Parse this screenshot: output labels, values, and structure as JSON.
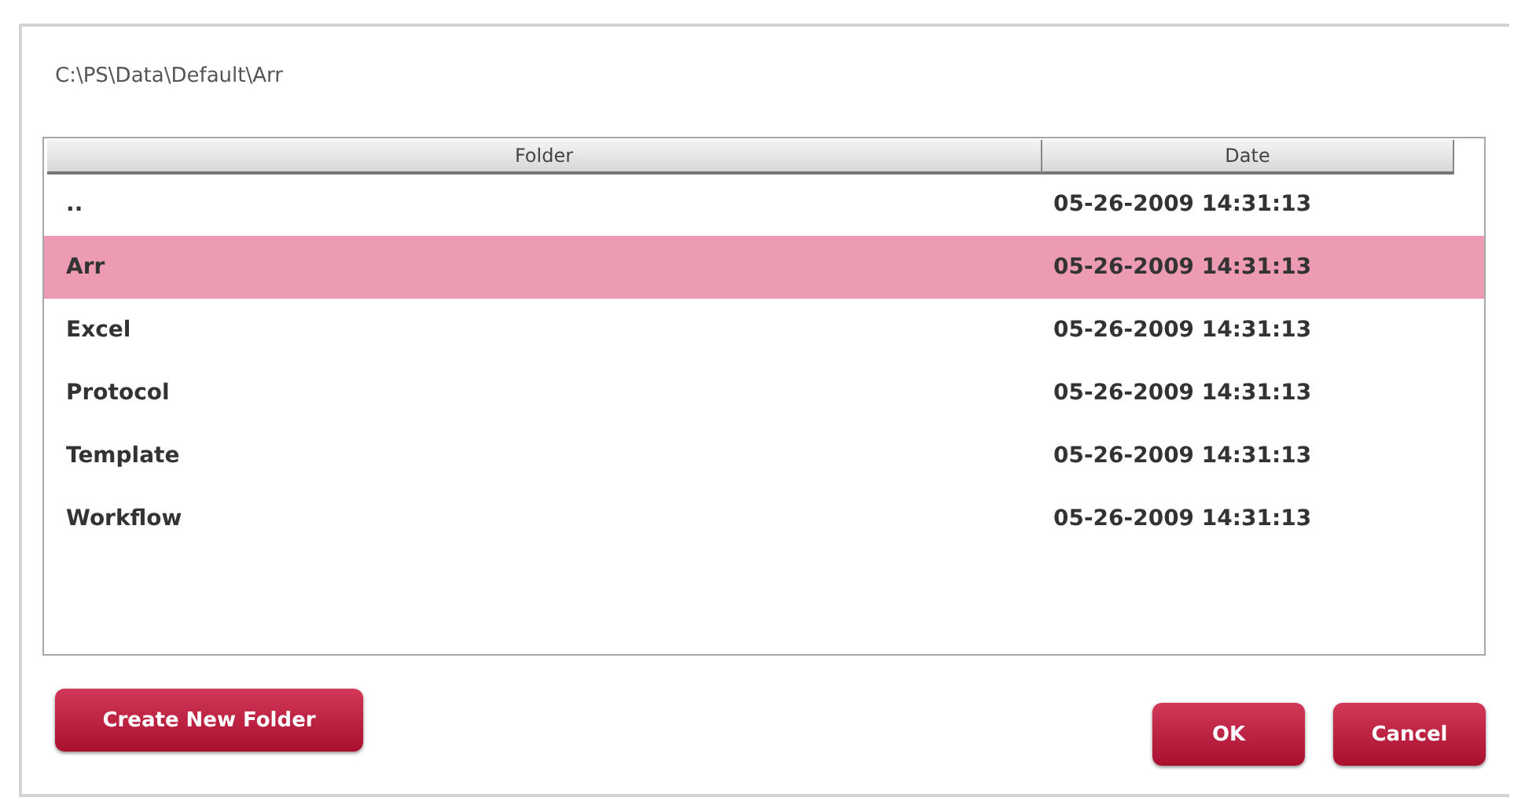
{
  "path": "C:\\PS\\Data\\Default\\Arr",
  "table": {
    "columns": [
      "Folder",
      "Date"
    ],
    "rows": [
      {
        "folder": "..",
        "date": "05-26-2009 14:31:13",
        "selected": false
      },
      {
        "folder": "Arr",
        "date": "05-26-2009 14:31:13",
        "selected": true
      },
      {
        "folder": "Excel",
        "date": "05-26-2009 14:31:13",
        "selected": false
      },
      {
        "folder": "Protocol",
        "date": "05-26-2009 14:31:13",
        "selected": false
      },
      {
        "folder": "Template",
        "date": "05-26-2009 14:31:13",
        "selected": false
      },
      {
        "folder": "Workflow",
        "date": "05-26-2009 14:31:13",
        "selected": false
      }
    ]
  },
  "buttons": {
    "create": "Create New Folder",
    "ok": "OK",
    "cancel": "Cancel"
  }
}
